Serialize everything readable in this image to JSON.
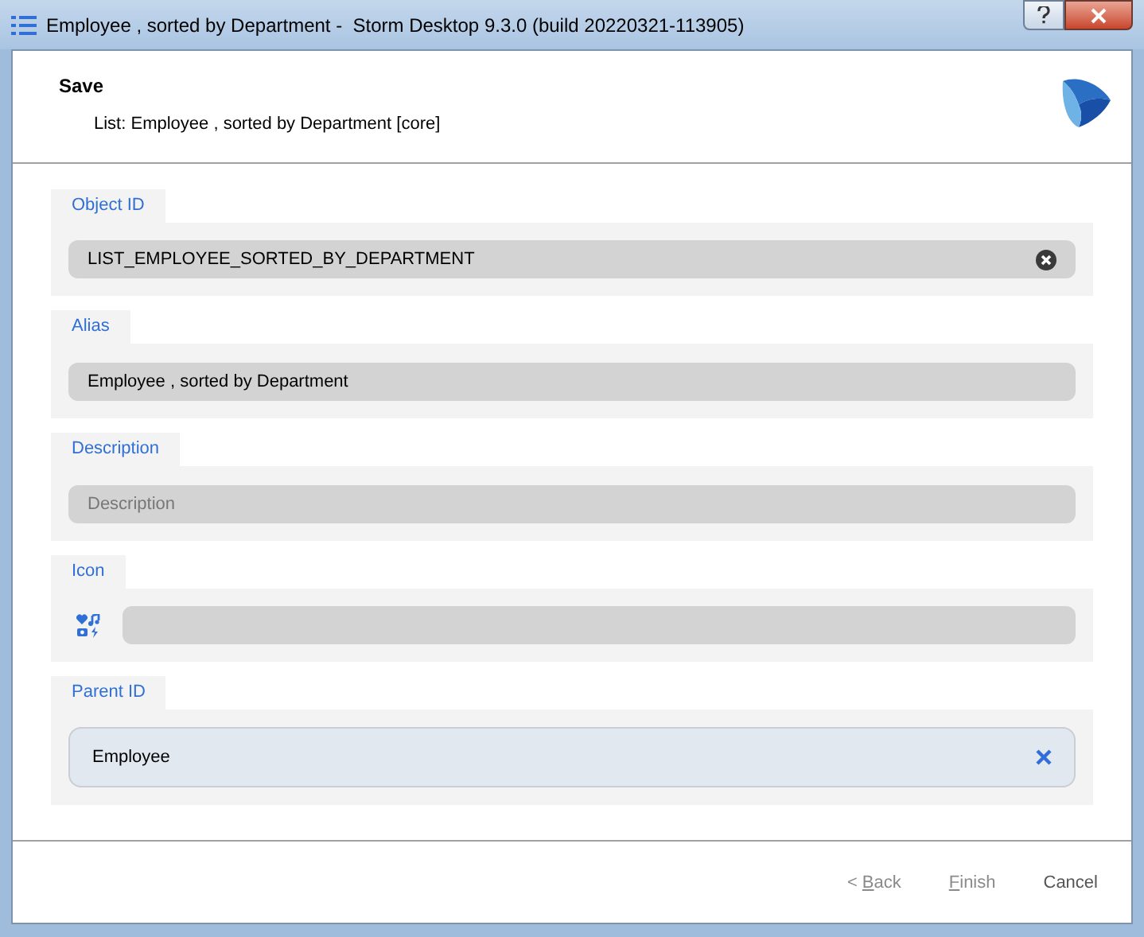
{
  "window": {
    "title": "Employee , sorted by Department -  Storm Desktop 9.3.0 (build 20220321-113905)"
  },
  "header": {
    "title": "Save",
    "subtitle": "List: Employee , sorted by Department [core]"
  },
  "fields": [
    {
      "kind": "clearable",
      "label": "Object ID",
      "value": "LIST_EMPLOYEE_SORTED_BY_DEPARTMENT"
    },
    {
      "kind": "text",
      "label": "Alias",
      "value": "Employee , sorted by Department"
    },
    {
      "kind": "text",
      "label": "Description",
      "placeholder": "Description"
    },
    {
      "kind": "icon",
      "label": "Icon"
    },
    {
      "kind": "lookup",
      "label": "Parent ID",
      "value": "Employee"
    }
  ],
  "buttons": [
    {
      "label": {
        "before": "< ",
        "key": "B",
        "after": "ack"
      },
      "disabled": true
    },
    {
      "label": {
        "key": "F",
        "after": "inish"
      },
      "disabled": true
    },
    {
      "label": {
        "before": "Cancel"
      },
      "disabled": false
    }
  ]
}
